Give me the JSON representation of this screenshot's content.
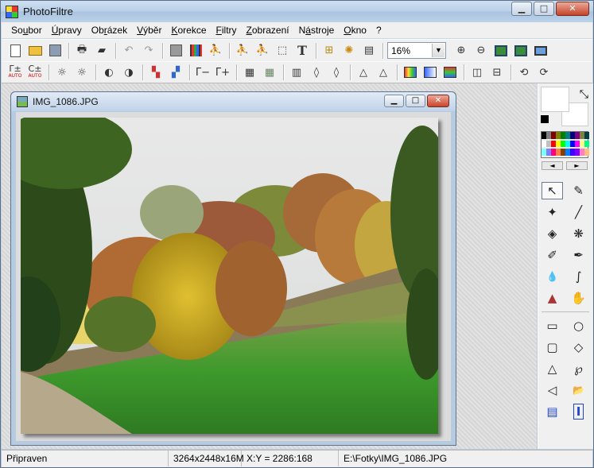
{
  "window": {
    "title": "PhotoFiltre",
    "minimize": "▁",
    "maximize": "□",
    "close": "✕"
  },
  "menu": [
    {
      "pre": "So",
      "u": "u",
      "post": "bor"
    },
    {
      "pre": "",
      "u": "Ú",
      "post": "pravy"
    },
    {
      "pre": "Ob",
      "u": "r",
      "post": "ázek"
    },
    {
      "pre": "",
      "u": "V",
      "post": "ýběr"
    },
    {
      "pre": "",
      "u": "K",
      "post": "orekce"
    },
    {
      "pre": "",
      "u": "F",
      "post": "iltry"
    },
    {
      "pre": "",
      "u": "Z",
      "post": "obrazení"
    },
    {
      "pre": "N",
      "u": "á",
      "post": "stroje"
    },
    {
      "pre": "",
      "u": "O",
      "post": "kno"
    },
    {
      "pre": "",
      "u": "?",
      "post": ""
    }
  ],
  "toolbar": {
    "zoom_value": "16%",
    "text_tool_glyph": "T",
    "auto_contrast": "Γ±",
    "auto_label": "AUTO",
    "gamma_minus": "Γ−",
    "gamma_plus": "Γ+"
  },
  "document": {
    "title": "IMG_1086.JPG",
    "minimize": "▁",
    "maximize": "□",
    "close": "✕"
  },
  "statusbar": {
    "state": "Připraven",
    "size": "3264x2448x16M",
    "coords": "X:Y = 2286:168",
    "path": "E:\\Fotky\\IMG_1086.JPG"
  },
  "colors": {
    "foreground": "#ffffff",
    "background": "#ffffff",
    "palette": [
      "#000000",
      "#808080",
      "#800000",
      "#808000",
      "#008000",
      "#008080",
      "#000080",
      "#800080",
      "#808040",
      "#004040",
      "#ffffff",
      "#c0c0c0",
      "#ff0000",
      "#ffff00",
      "#00ff00",
      "#00ffff",
      "#0000ff",
      "#ff00ff",
      "#ffff80",
      "#00ff80",
      "#80ffff",
      "#8080ff",
      "#ff0080",
      "#ff8040",
      "#804000",
      "#0080ff",
      "#4000ff",
      "#8000ff",
      "#ff80c0",
      "#ffc080"
    ]
  },
  "tools_icons": {
    "selection": "↖",
    "picker": "✎",
    "wand": "✦",
    "line": "╱",
    "fill": "◈",
    "spray": "❋",
    "brush": "✐",
    "brush_adv": "✒",
    "blur": "💧",
    "smudge": "∫",
    "stamp": "▲",
    "hand": "✋",
    "rect": "▭",
    "ellipse": "○",
    "rounded": "▢",
    "diamond": "◇",
    "triangle": "△",
    "lasso": "℘",
    "polygon": "◁",
    "folder": "📂",
    "select_all": "▤",
    "text_cursor": "I"
  }
}
